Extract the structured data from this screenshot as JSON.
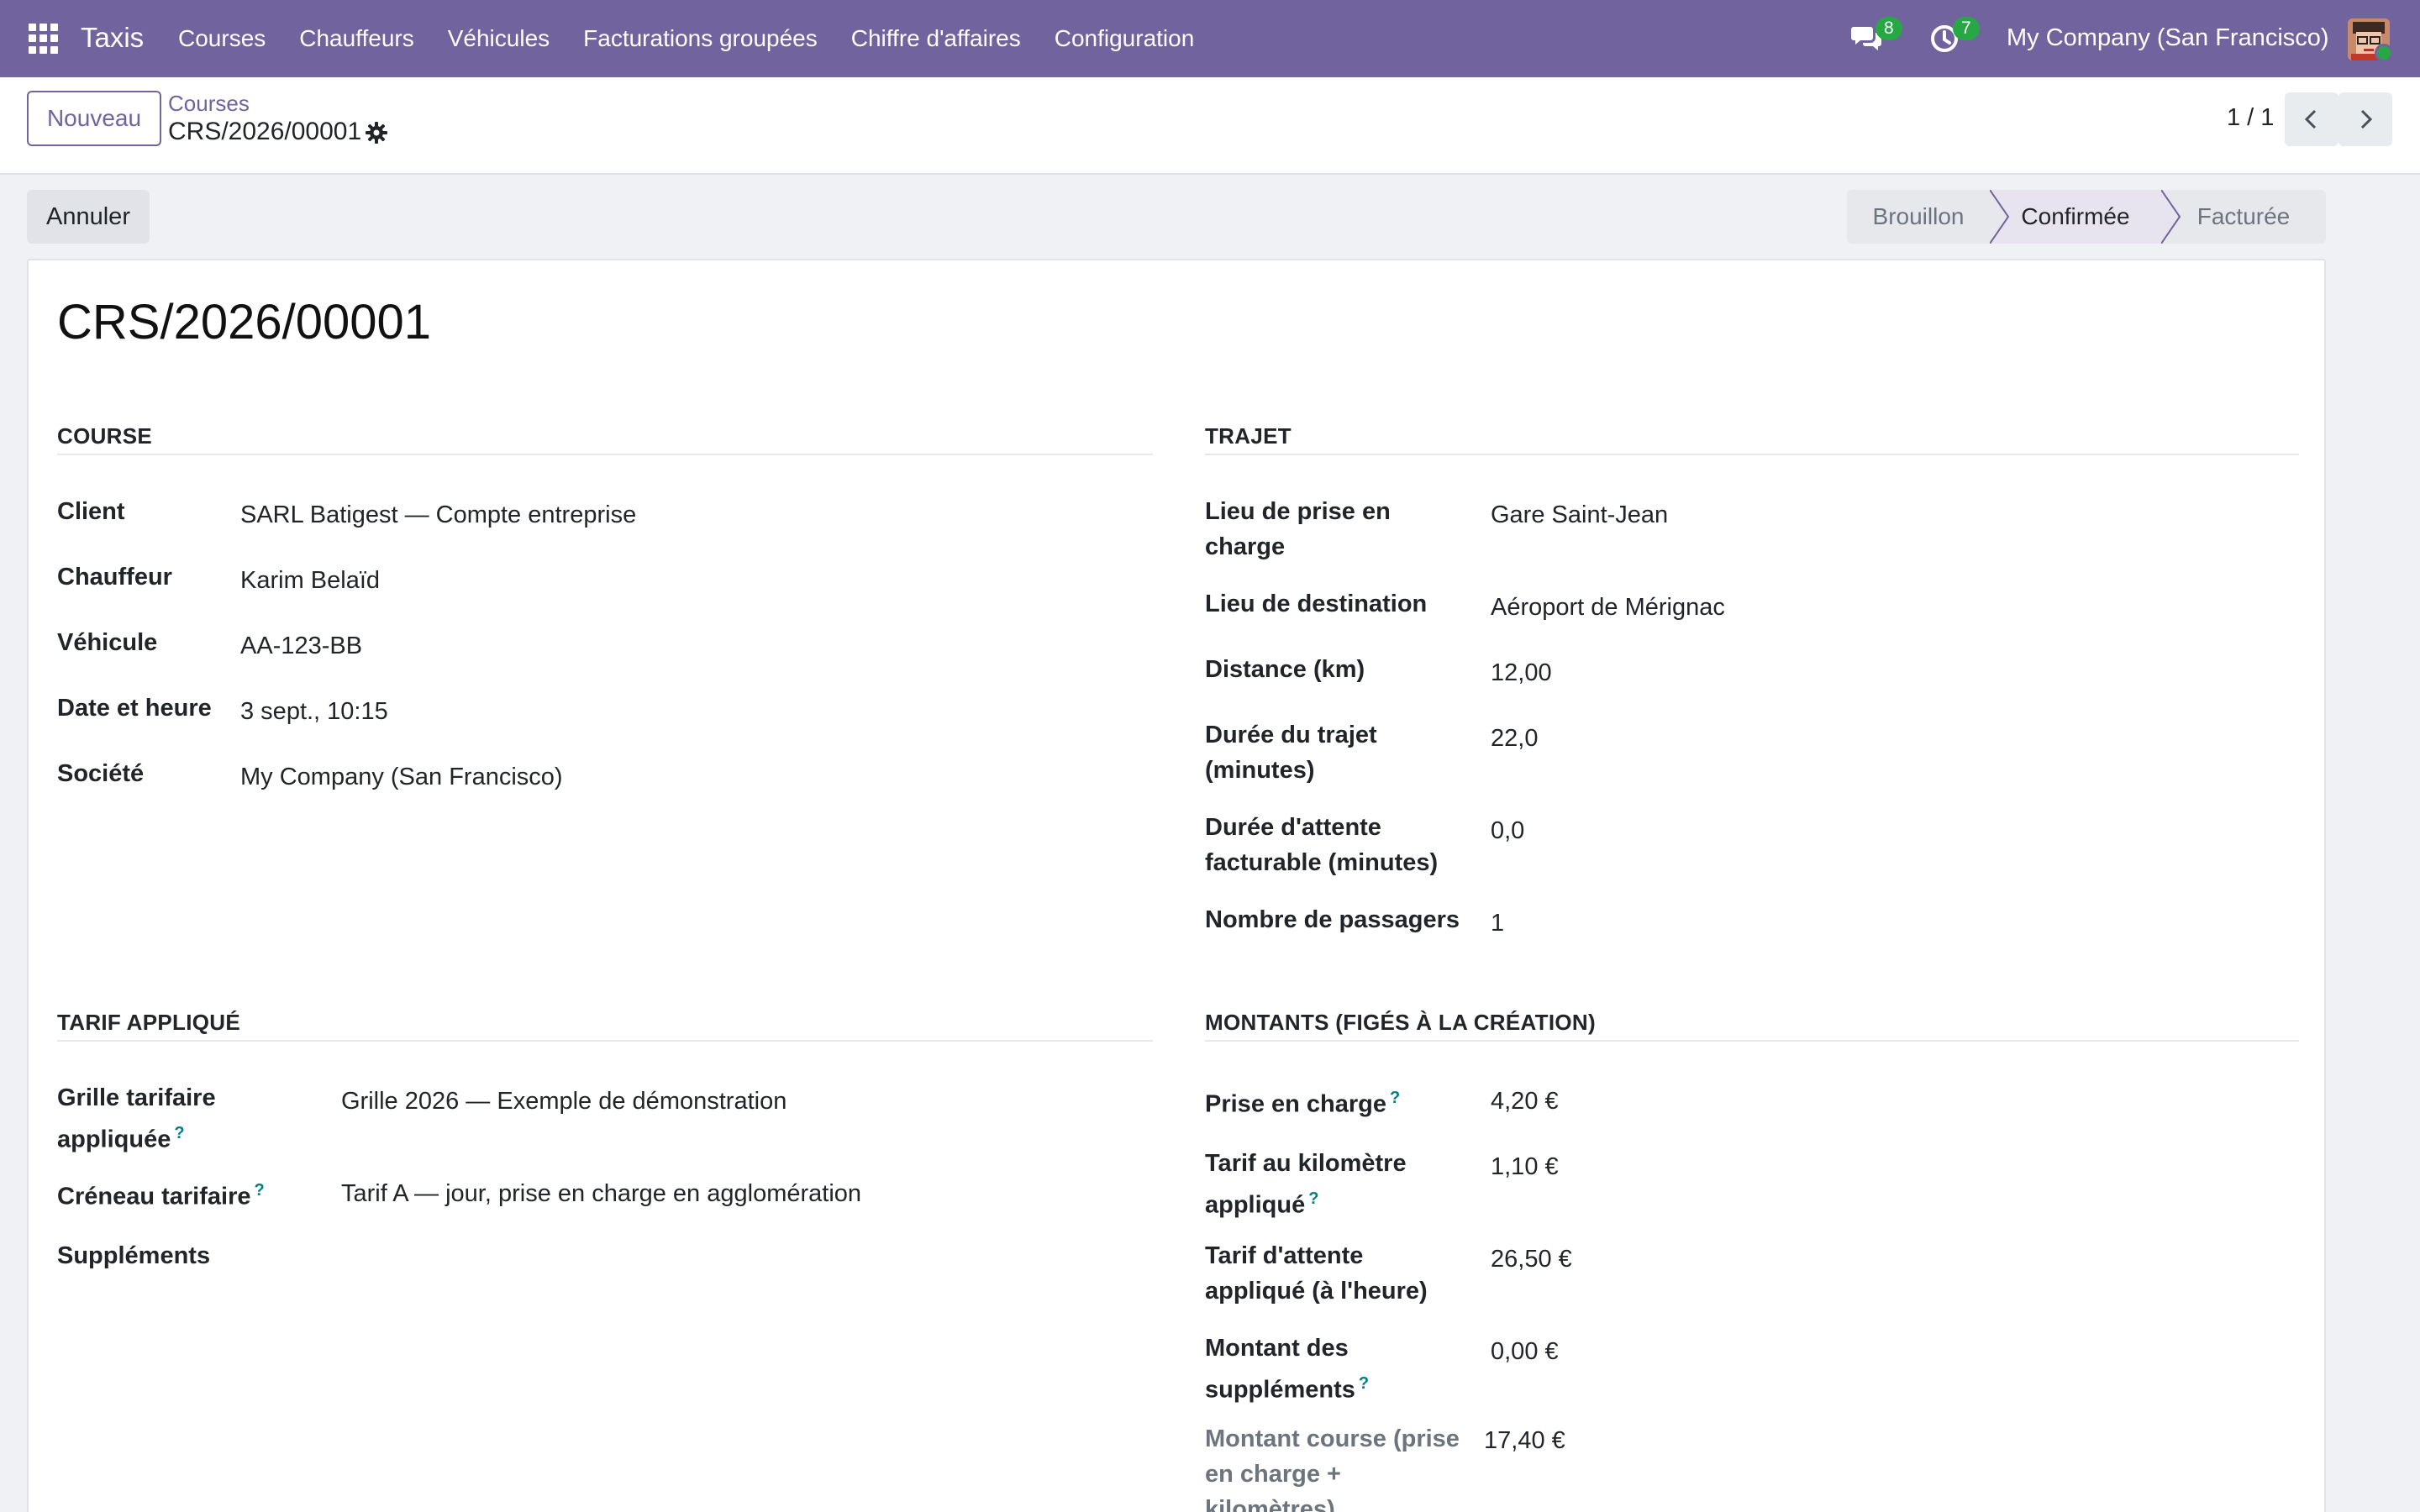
{
  "nav": {
    "brand": "Taxis",
    "menu": [
      "Courses",
      "Chauffeurs",
      "Véhicules",
      "Facturations groupées",
      "Chiffre d'affaires",
      "Configuration"
    ],
    "messages_count": "8",
    "activities_count": "7",
    "company": "My Company (San Francisco)"
  },
  "control": {
    "new_label": "Nouveau",
    "breadcrumb_parent": "Courses",
    "breadcrumb_current": "CRS/2026/00001",
    "pager": "1 / 1"
  },
  "actions": {
    "cancel_label": "Annuler"
  },
  "status": {
    "stages": [
      "Brouillon",
      "Confirmée",
      "Facturée"
    ],
    "current": "Confirmée"
  },
  "record": {
    "title": "CRS/2026/00001"
  },
  "course": {
    "heading": "COURSE",
    "fields": [
      {
        "label": "Client",
        "value": "SARL Batigest — Compte entreprise"
      },
      {
        "label": "Chauffeur",
        "value": "Karim Belaïd"
      },
      {
        "label": "Véhicule",
        "value": "AA-123-BB"
      },
      {
        "label": "Date et heure",
        "value": "3 sept., 10:15"
      },
      {
        "label": "Société",
        "value": "My Company (San Francisco)"
      }
    ]
  },
  "trajet": {
    "heading": "TRAJET",
    "fields": [
      {
        "label_1": "Lieu de prise en",
        "label_2": "charge",
        "value": "Gare Saint-Jean"
      },
      {
        "label_1": "Lieu de destination",
        "value": "Aéroport de Mérignac"
      },
      {
        "label_1": "Distance (km)",
        "value": "12,00"
      },
      {
        "label_1": "Durée du trajet",
        "label_2": "(minutes)",
        "value": "22,0"
      },
      {
        "label_1": "Durée d'attente",
        "label_2": "facturable (minutes)",
        "value": "0,0"
      },
      {
        "label_1": "Nombre de passagers",
        "value": "1"
      }
    ]
  },
  "tarif": {
    "heading": "TARIF APPLIQUÉ",
    "fields": [
      {
        "label_1": "Grille tarifaire",
        "label_2": "appliquée",
        "help": "?",
        "value": "Grille 2026 — Exemple de démonstration"
      },
      {
        "label_1": "Créneau tarifaire",
        "help": "?",
        "value": "Tarif A — jour, prise en charge en agglomération"
      },
      {
        "label_1": "Suppléments"
      }
    ]
  },
  "montants": {
    "heading": "MONTANTS (FIGÉS À LA CRÉATION)",
    "fields": [
      {
        "label_1": "Prise en charge",
        "help": "?",
        "value": "4,20 €"
      },
      {
        "label_1": "Tarif au kilomètre",
        "label_2": "appliqué",
        "help": "?",
        "value": "1,10 €"
      },
      {
        "label_1": "Tarif d'attente",
        "label_2": "appliqué (à l'heure)",
        "value": "26,50 €"
      },
      {
        "label_1": "Montant des",
        "label_2": "suppléments",
        "help": "?",
        "value": "0,00 €"
      },
      {
        "label_1": "Montant course (prise",
        "label_2": "en charge +",
        "label_3": "kilomètres)",
        "value": "17,40 €"
      }
    ]
  }
}
